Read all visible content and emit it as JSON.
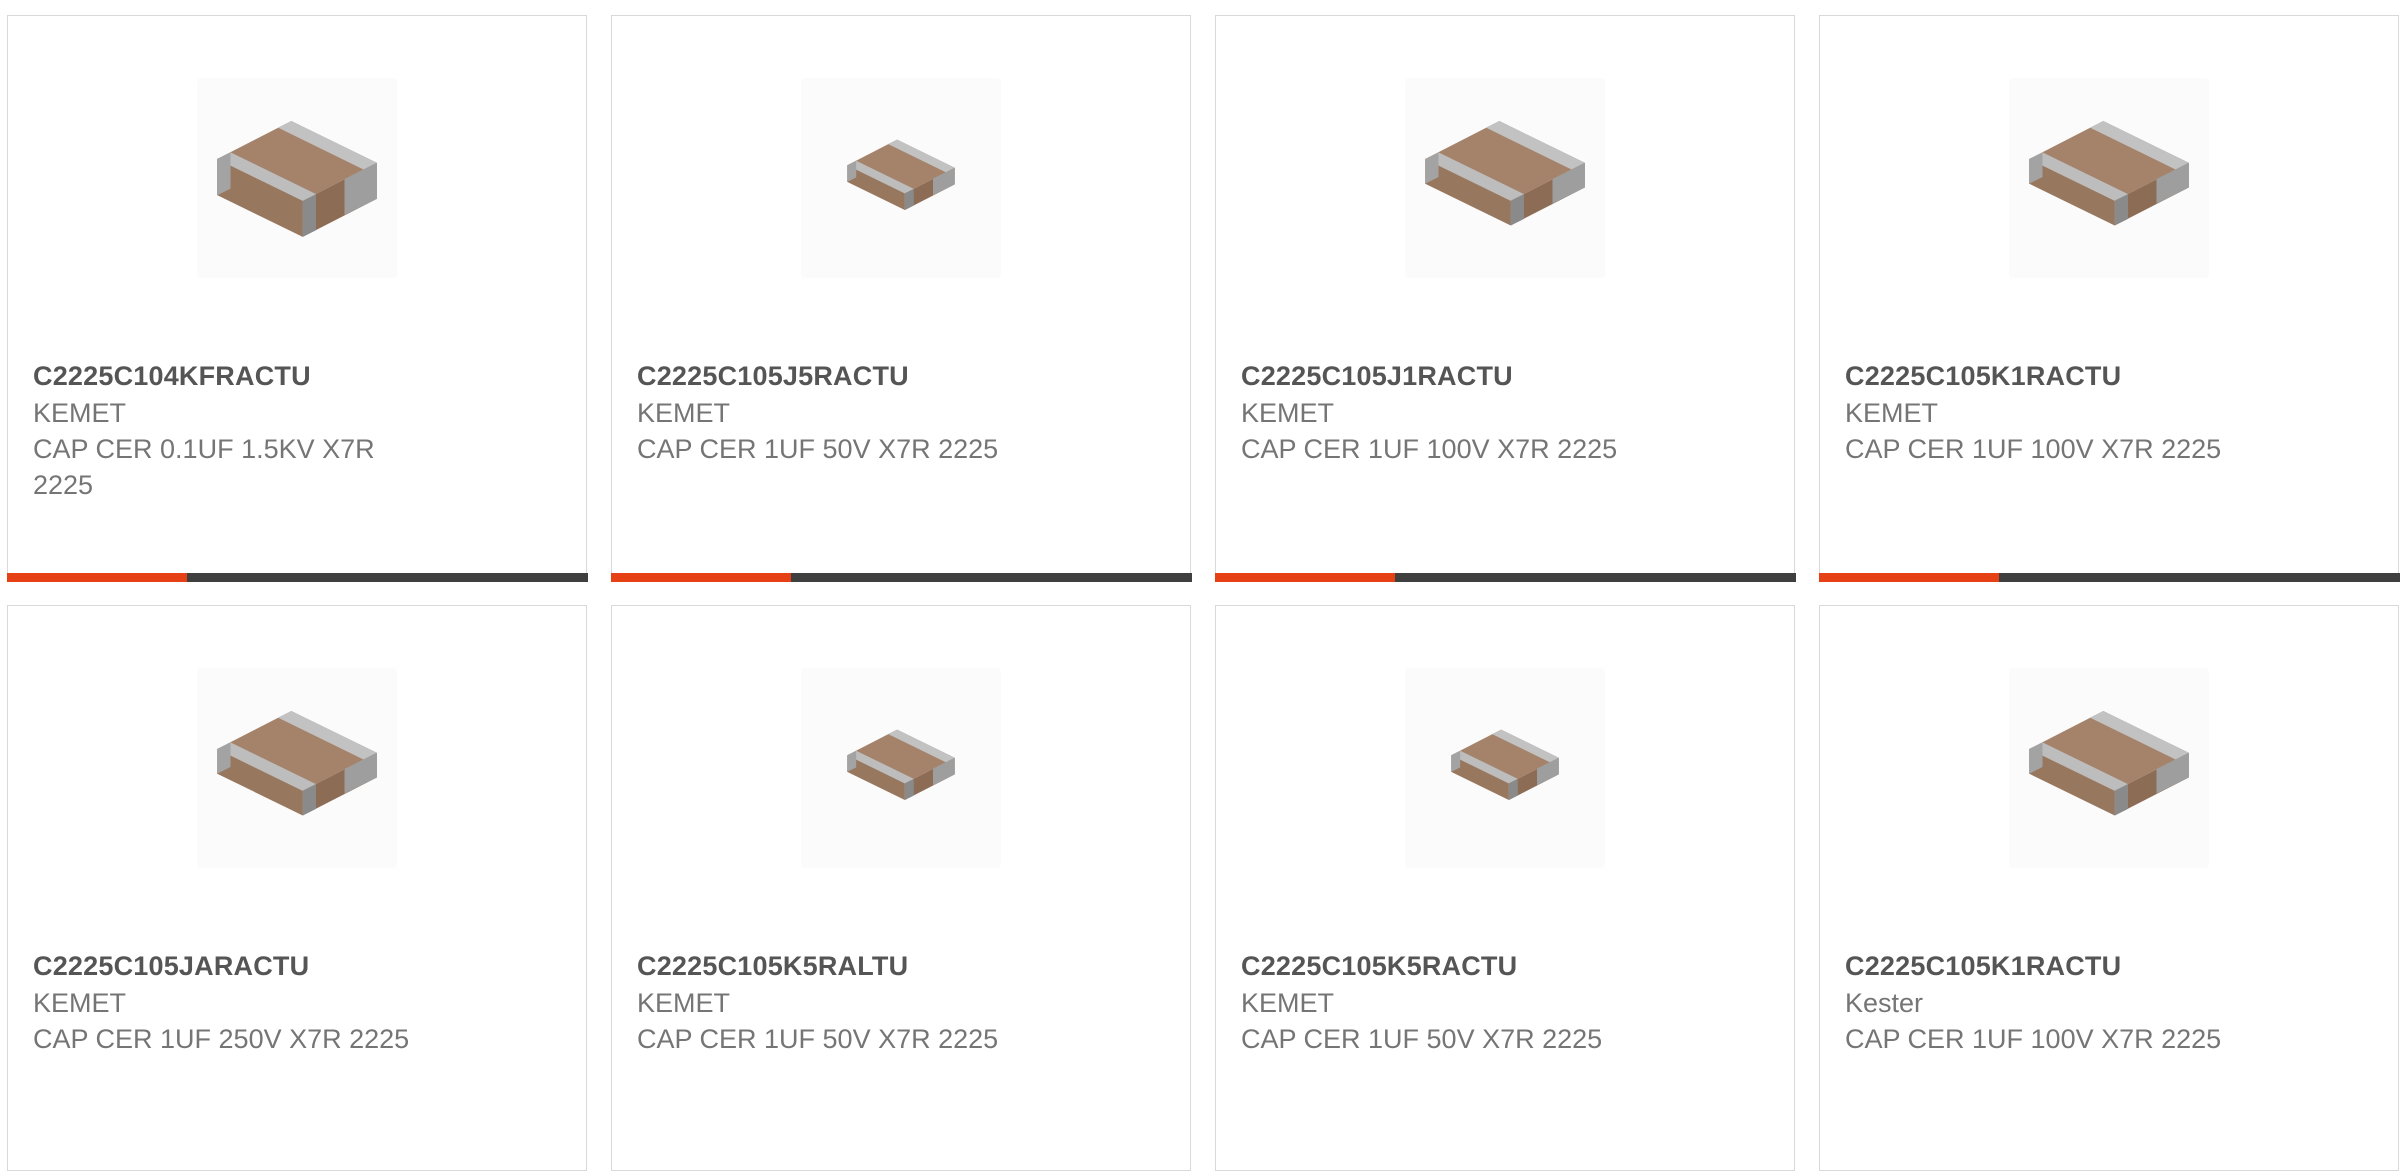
{
  "colors": {
    "accent": "#e64114",
    "bar_track": "#3f3f3f",
    "part_text": "#555555",
    "secondary_text": "#757575",
    "border": "#d9d9d9"
  },
  "product_image_icon": "smd-ceramic-capacitor-icon",
  "products": [
    {
      "part": "C2225C104KFRACTU",
      "manufacturer": "KEMET",
      "description": "CAP CER 0.1UF 1.5KV X7R 2225",
      "progress_fraction": 0.31
    },
    {
      "part": "C2225C105J5RACTU",
      "manufacturer": "KEMET",
      "description": "CAP CER 1UF 50V X7R 2225",
      "progress_fraction": 0.31
    },
    {
      "part": "C2225C105J1RACTU",
      "manufacturer": "KEMET",
      "description": "CAP CER 1UF 100V X7R 2225",
      "progress_fraction": 0.31
    },
    {
      "part": "C2225C105K1RACTU",
      "manufacturer": "KEMET",
      "description": "CAP CER 1UF 100V X7R 2225",
      "progress_fraction": 0.31
    },
    {
      "part": "C2225C105JARACTU",
      "manufacturer": "KEMET",
      "description": "CAP CER 1UF 250V X7R 2225"
    },
    {
      "part": "C2225C105K5RALTU",
      "manufacturer": "KEMET",
      "description": "CAP CER 1UF 50V X7R 2225"
    },
    {
      "part": "C2225C105K5RACTU",
      "manufacturer": "KEMET",
      "description": "CAP CER 1UF 50V X7R 2225"
    },
    {
      "part": "C2225C105K1RACTU",
      "manufacturer": "Kester",
      "description": "CAP CER 1UF 100V X7R 2225"
    }
  ]
}
